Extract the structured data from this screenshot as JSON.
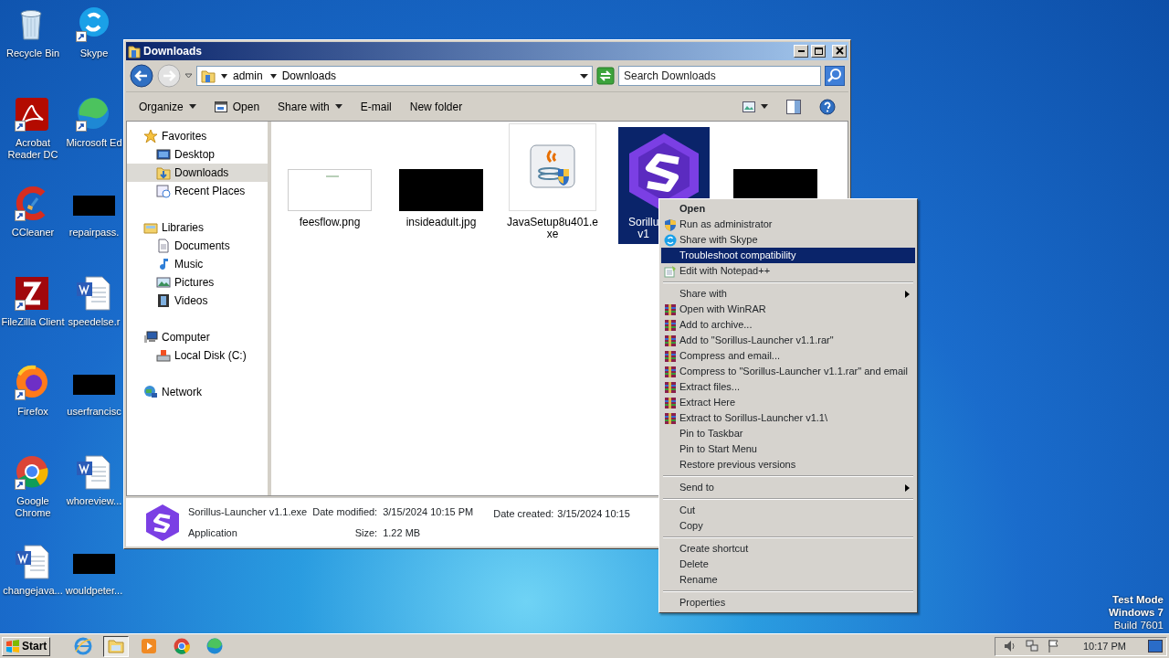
{
  "desktop_icons": [
    {
      "label": "Recycle Bin",
      "kind": "recycle",
      "shortcut": false
    },
    {
      "label": "Skype",
      "kind": "skype",
      "shortcut": true
    },
    {
      "label": "Acrobat Reader DC",
      "kind": "pdf",
      "shortcut": true
    },
    {
      "label": "Microsoft Ed",
      "kind": "edge",
      "shortcut": true
    },
    {
      "label": "CCleaner",
      "kind": "ccleaner",
      "shortcut": true
    },
    {
      "label": "repairpass.",
      "kind": "redacted",
      "shortcut": false
    },
    {
      "label": "FileZilla Client",
      "kind": "filezilla",
      "shortcut": true
    },
    {
      "label": "speedelse.r",
      "kind": "word",
      "shortcut": false
    },
    {
      "label": "Firefox",
      "kind": "firefox",
      "shortcut": true
    },
    {
      "label": "userfrancisc",
      "kind": "redacted",
      "shortcut": false
    },
    {
      "label": "Google Chrome",
      "kind": "chrome",
      "shortcut": true
    },
    {
      "label": "whoreview...",
      "kind": "word",
      "shortcut": false
    },
    {
      "label": "changejava...",
      "kind": "word",
      "shortcut": false
    },
    {
      "label": "wouldpeter...",
      "kind": "redacted",
      "shortcut": false
    }
  ],
  "explorer": {
    "title": "Downloads",
    "address": {
      "segments": [
        "admin",
        "Downloads"
      ]
    },
    "search": {
      "placeholder": "Search Downloads"
    },
    "toolbar": [
      {
        "label": "Organize",
        "kind": "text",
        "dropdown": true
      },
      {
        "label": "Open",
        "kind": "open",
        "dropdown": false
      },
      {
        "label": "Share with",
        "kind": "text",
        "dropdown": true
      },
      {
        "label": "E-mail",
        "kind": "text",
        "dropdown": false
      },
      {
        "label": "New folder",
        "kind": "text",
        "dropdown": false
      }
    ],
    "nav": [
      {
        "label": "Favorites",
        "kind": "star",
        "selected": false,
        "children": [
          {
            "label": "Desktop",
            "kind": "desktop",
            "selected": false
          },
          {
            "label": "Downloads",
            "kind": "downloads",
            "selected": true
          },
          {
            "label": "Recent Places",
            "kind": "recent",
            "selected": false
          }
        ]
      },
      {
        "label": "Libraries",
        "kind": "library",
        "selected": false,
        "children": [
          {
            "label": "Documents",
            "kind": "documents",
            "selected": false
          },
          {
            "label": "Music",
            "kind": "music",
            "selected": false
          },
          {
            "label": "Pictures",
            "kind": "pictures",
            "selected": false
          },
          {
            "label": "Videos",
            "kind": "videos",
            "selected": false
          }
        ]
      },
      {
        "label": "Computer",
        "kind": "computer",
        "selected": false,
        "children": [
          {
            "label": "Local Disk (C:)",
            "kind": "disk",
            "selected": false
          }
        ]
      },
      {
        "label": "Network",
        "kind": "network",
        "selected": false
      }
    ],
    "files": [
      {
        "lines": [
          "feesflow.png"
        ],
        "kind": "light-thumb",
        "selected": false
      },
      {
        "lines": [
          "insideadult.jpg"
        ],
        "kind": "dark-thumb",
        "selected": false
      },
      {
        "lines": [
          "JavaSetup8u401.e",
          "xe"
        ],
        "kind": "java",
        "selected": false
      },
      {
        "lines": [
          "Sorillu",
          "v1"
        ],
        "kind": "launcher",
        "selected": true
      },
      {
        "kind": "dark-thumb",
        "selected": false
      }
    ],
    "details": {
      "name": "Sorillus-Launcher v1.1.exe",
      "type": "Application",
      "modified_label": "Date modified:",
      "modified": "3/15/2024 10:15 PM",
      "size_label": "Size:",
      "size": "1.22 MB",
      "created_label": "Date created:",
      "created": "3/15/2024 10:15"
    }
  },
  "context_menu": {
    "groups": [
      [
        {
          "label": "Open",
          "kind": "default",
          "selected": false
        },
        {
          "label": "Run as administrator",
          "kind": "shield",
          "selected": false
        },
        {
          "label": "Share with Skype",
          "kind": "skype",
          "selected": false
        },
        {
          "label": "Troubleshoot compatibility",
          "kind": "plain",
          "selected": true
        },
        {
          "label": "Edit with Notepad++",
          "kind": "notepad",
          "selected": false
        }
      ],
      [
        {
          "label": "Share with",
          "kind": "submenu",
          "selected": false
        },
        {
          "label": "Open with WinRAR",
          "kind": "winrar",
          "selected": false
        },
        {
          "label": "Add to archive...",
          "kind": "winrar",
          "selected": false
        },
        {
          "label": "Add to \"Sorillus-Launcher v1.1.rar\"",
          "kind": "winrar",
          "selected": false
        },
        {
          "label": "Compress and email...",
          "kind": "winrar",
          "selected": false
        },
        {
          "label": "Compress to \"Sorillus-Launcher v1.1.rar\" and email",
          "kind": "winrar",
          "selected": false
        },
        {
          "label": "Extract files...",
          "kind": "winrar",
          "selected": false
        },
        {
          "label": "Extract Here",
          "kind": "winrar",
          "selected": false
        },
        {
          "label": "Extract to Sorillus-Launcher v1.1\\",
          "kind": "winrar",
          "selected": false
        },
        {
          "label": "Pin to Taskbar",
          "kind": "plain",
          "selected": false
        },
        {
          "label": "Pin to Start Menu",
          "kind": "plain",
          "selected": false
        },
        {
          "label": "Restore previous versions",
          "kind": "plain",
          "selected": false
        }
      ],
      [
        {
          "label": "Send to",
          "kind": "submenu",
          "selected": false
        }
      ],
      [
        {
          "label": "Cut",
          "kind": "plain",
          "selected": false
        },
        {
          "label": "Copy",
          "kind": "plain",
          "selected": false
        }
      ],
      [
        {
          "label": "Create shortcut",
          "kind": "plain",
          "selected": false
        },
        {
          "label": "Delete",
          "kind": "plain",
          "selected": false
        },
        {
          "label": "Rename",
          "kind": "plain",
          "selected": false
        }
      ],
      [
        {
          "label": "Properties",
          "kind": "plain",
          "selected": false
        }
      ]
    ]
  },
  "system_notice": [
    "Test Mode",
    "Windows 7",
    "Build 7601"
  ],
  "taskbar": {
    "start": "Start",
    "apps": [
      {
        "kind": "ie",
        "selected": false
      },
      {
        "kind": "explorer",
        "selected": true
      },
      {
        "kind": "media",
        "selected": false
      },
      {
        "kind": "chrome",
        "selected": false
      },
      {
        "kind": "edge",
        "selected": false
      }
    ],
    "clock": "10:17 PM"
  }
}
